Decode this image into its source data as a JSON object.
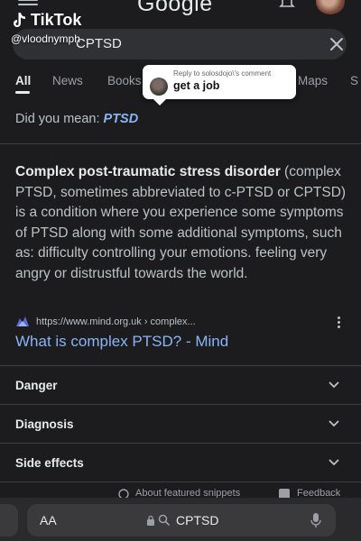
{
  "header": {
    "logo_text": "Google"
  },
  "tiktok": {
    "brand": "TikTok",
    "username": "@vloodnymph"
  },
  "search": {
    "query": "CPTSD"
  },
  "tabs": [
    {
      "label": "All",
      "active": true
    },
    {
      "label": "News",
      "active": false
    },
    {
      "label": "Books",
      "active": false
    },
    {
      "label": "Maps",
      "active": false
    },
    {
      "label": "S",
      "active": false
    }
  ],
  "comment_reply": {
    "meta": "Reply to solosdojo\\'s comment",
    "text": "get a job"
  },
  "did_you_mean": {
    "prefix": "Did you mean:",
    "suggestion": "PTSD"
  },
  "snippet": {
    "bold": "Complex post-traumatic stress disorder",
    "text": "(complex PTSD, sometimes abbreviated to c-PTSD or CPTSD) is a condition where you experience some symptoms of PTSD along with some additional symptoms, such as: difficulty controlling your emotions. feeling very angry or distrustful towards the world."
  },
  "result": {
    "url": "https://www.mind.org.uk › complex...",
    "title": "What is complex PTSD? - Mind"
  },
  "accordions": [
    {
      "label": "Danger"
    },
    {
      "label": "Diagnosis"
    },
    {
      "label": "Side effects"
    }
  ],
  "footer": {
    "about": "About featured snippets",
    "feedback": "Feedback"
  },
  "browser": {
    "aa_label": "AA",
    "address": "CPTSD"
  },
  "colors": {
    "background": "#1c1c1e",
    "link": "#8ab4f8",
    "text": "#bdc1c6",
    "heading": "#e8eaed"
  }
}
